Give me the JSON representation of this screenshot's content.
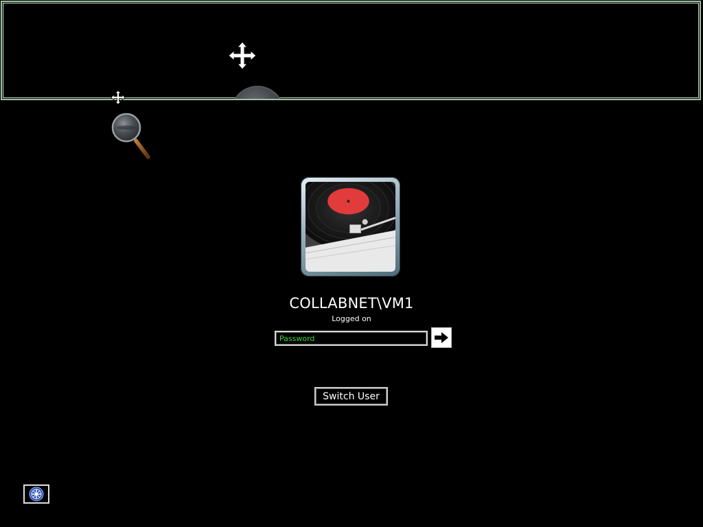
{
  "user": {
    "name": "COLLABNET\\VM1",
    "status": "Logged on",
    "avatar_icon": "record-player-icon"
  },
  "password": {
    "placeholder": "Password",
    "value": ""
  },
  "submit": {
    "icon": "arrow-right-icon"
  },
  "switch_user": {
    "label": "Switch User"
  },
  "ease_of_access": {
    "icon": "ease-of-access-icon"
  },
  "magnifier": {
    "icons": [
      "move-icon",
      "magnifier-glass-icon"
    ]
  },
  "colors": {
    "background": "#000000",
    "password_text": "#3bd13b",
    "magnifier_border": "#9fc4a4"
  }
}
